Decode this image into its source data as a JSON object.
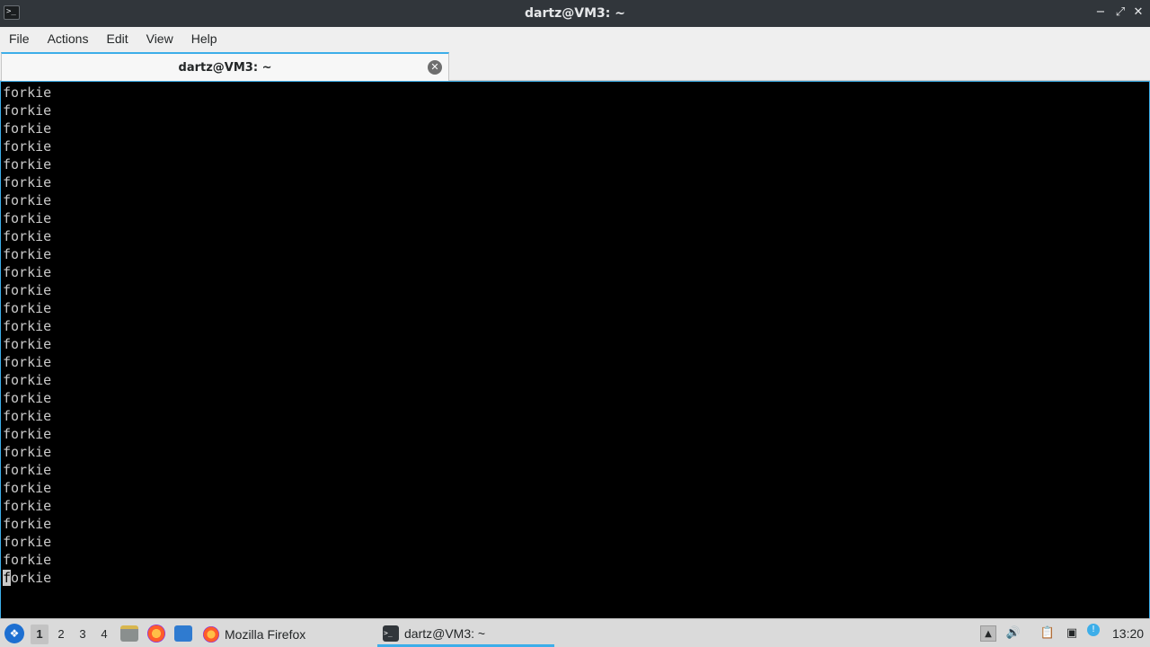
{
  "window": {
    "title": "dartz@VM3: ~",
    "icon": "terminal-icon",
    "controls": {
      "minimize_icon": "minimize-icon",
      "maximize_icon": "maximize-icon",
      "close_icon": "close-icon"
    }
  },
  "menu": {
    "items": [
      "File",
      "Actions",
      "Edit",
      "View",
      "Help"
    ]
  },
  "tabs": [
    {
      "label": "dartz@VM3: ~",
      "active": true
    }
  ],
  "terminal": {
    "lines": [
      "forkie",
      "forkie",
      "forkie",
      "forkie",
      "forkie",
      "forkie",
      "forkie",
      "forkie",
      "forkie",
      "forkie",
      "forkie",
      "forkie",
      "forkie",
      "forkie",
      "forkie",
      "forkie",
      "forkie",
      "forkie",
      "forkie",
      "forkie",
      "forkie",
      "forkie",
      "forkie",
      "forkie",
      "forkie",
      "forkie",
      "forkie",
      "forkie"
    ],
    "last_line_cursor_char": "f",
    "last_line_rest": "orkie",
    "background": "#000000",
    "foreground": "#c9c9c9"
  },
  "taskbar": {
    "desktops": [
      "1",
      "2",
      "3",
      "4"
    ],
    "active_desktop": "1",
    "tasks": [
      {
        "label": "Mozilla Firefox",
        "icon": "firefox-icon",
        "active": false
      },
      {
        "label": "dartz@VM3: ~",
        "icon": "terminal-icon",
        "active": true
      }
    ],
    "clock": "13:20"
  },
  "colors": {
    "accent": "#3daee9",
    "titlebar": "#31363b"
  }
}
